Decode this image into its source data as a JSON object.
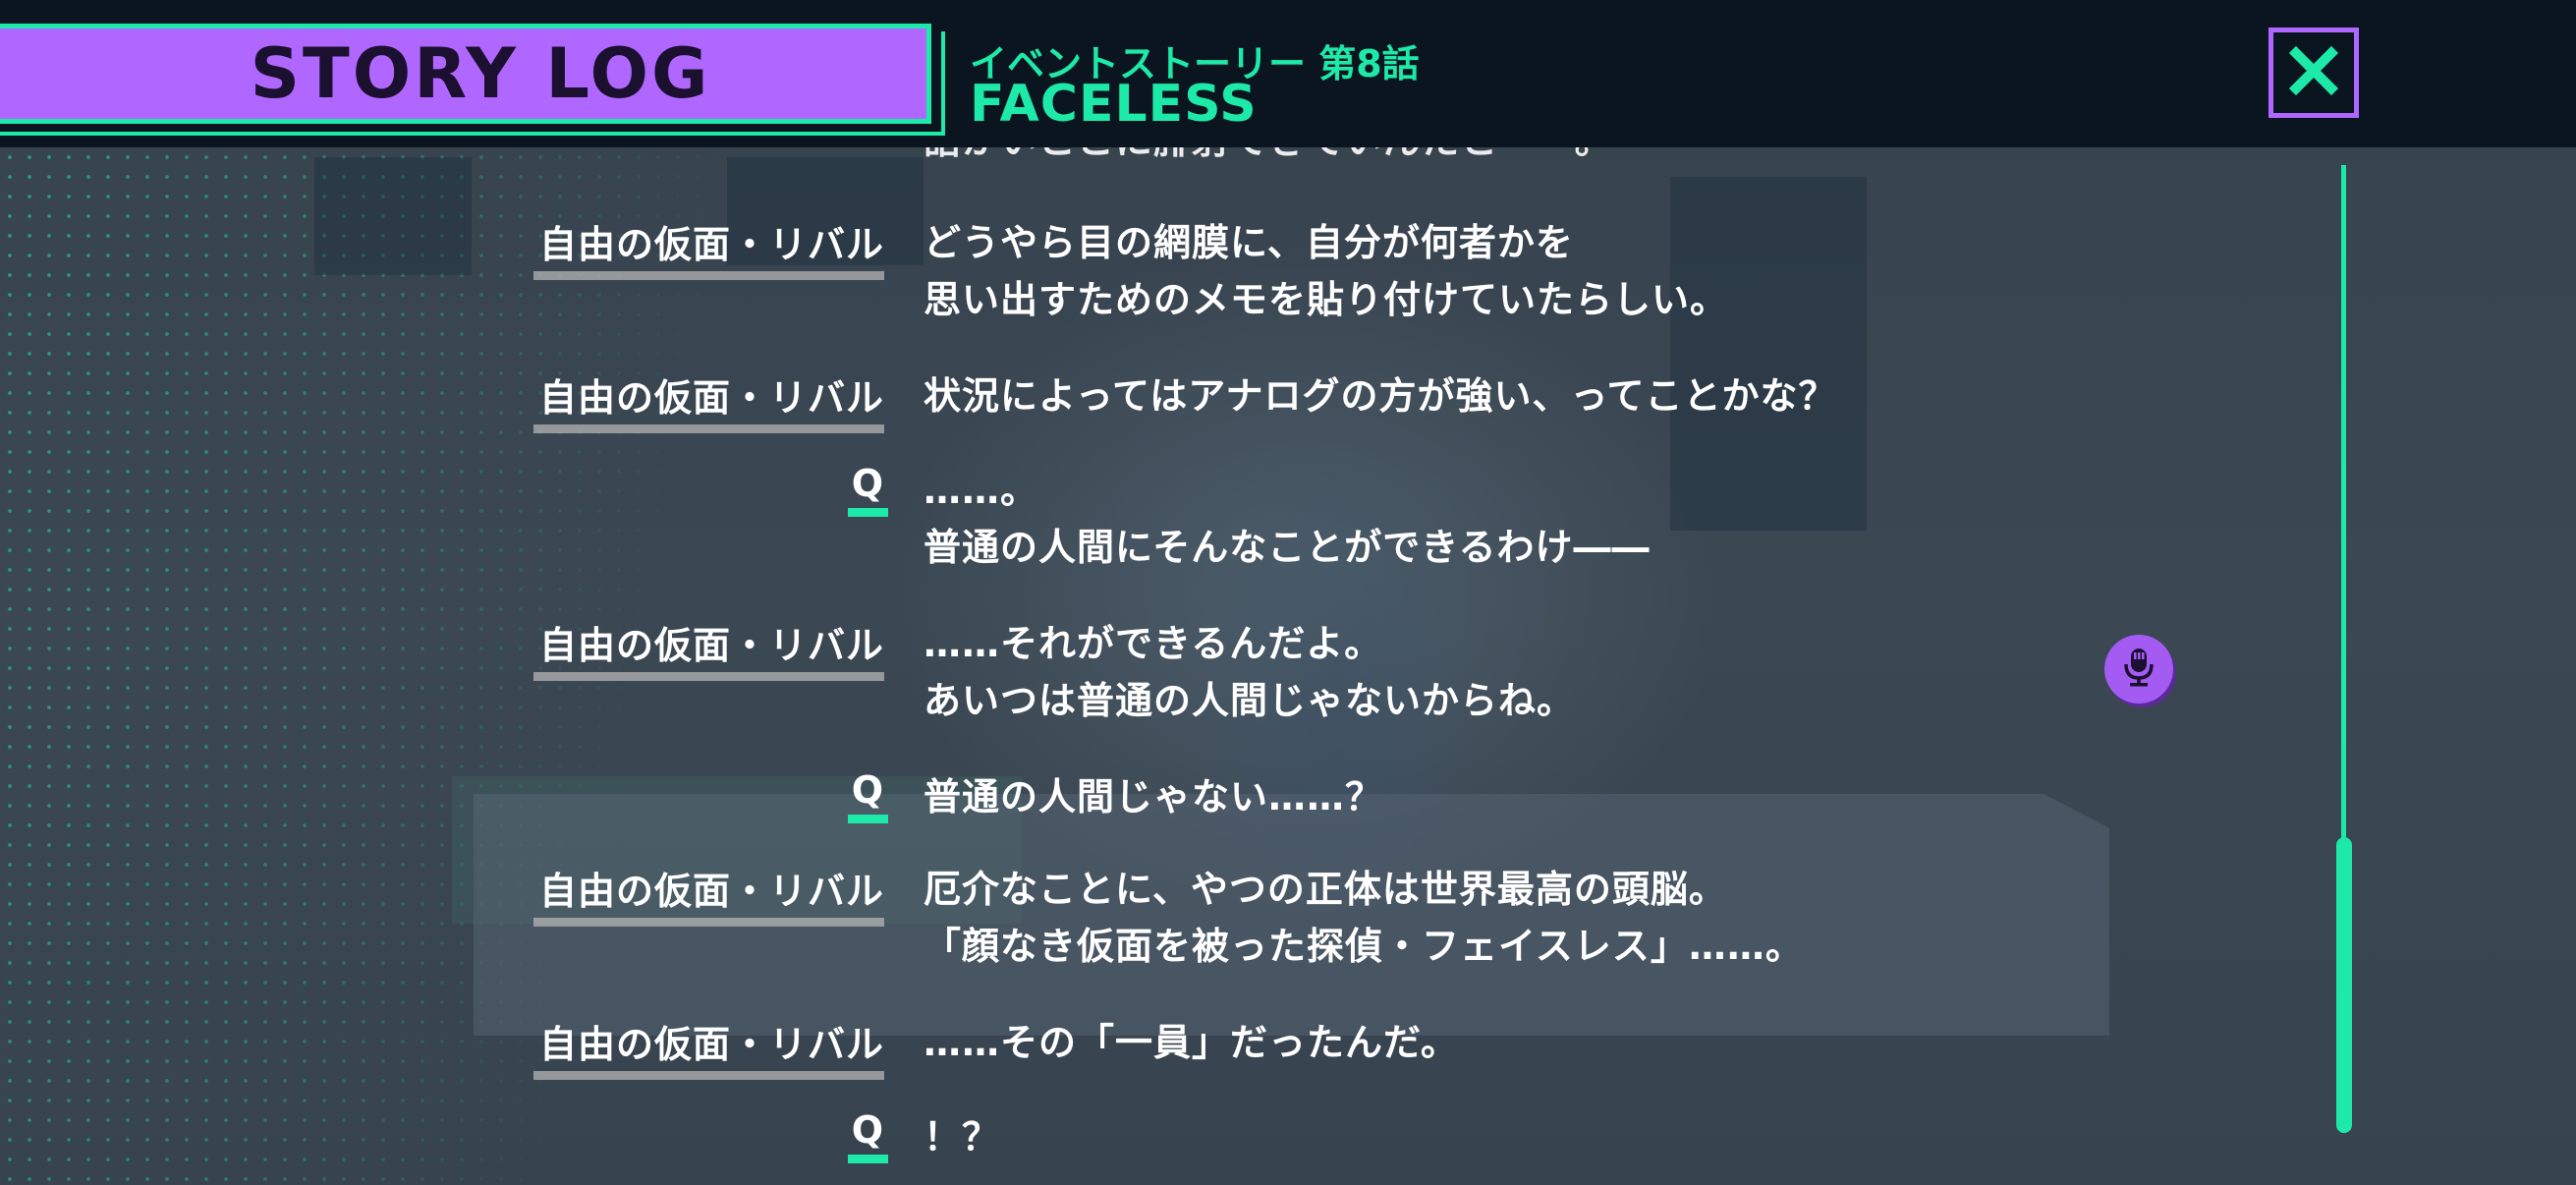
{
  "header": {
    "title": "STORY LOG",
    "episode_label": "イベントストーリー 第8話",
    "episode_title": "FACELESS",
    "close_icon": "close-icon"
  },
  "log": {
    "cut_line": "語かいここに腓射てさていんたとーー。",
    "entries": [
      {
        "speaker": "自由の仮面・リバル",
        "lines": [
          "どうやら目の網膜に、自分が何者かを",
          "思い出すためのメモを貼り付けていたらしい。"
        ]
      },
      {
        "speaker": "自由の仮面・リバル",
        "lines": [
          "状況によってはアナログの方が強い、ってことかな？"
        ]
      },
      {
        "speaker": "Q",
        "lines": [
          "……。",
          "普通の人間にそんなことができるわけ――"
        ]
      },
      {
        "speaker": "自由の仮面・リバル",
        "lines": [
          "……それができるんだよ。",
          "あいつは普通の人間じゃないからね。"
        ]
      },
      {
        "speaker": "Q",
        "lines": [
          "普通の人間じゃない……？"
        ]
      },
      {
        "speaker": "自由の仮面・リバル",
        "lines": [
          "厄介なことに、やつの正体は世界最高の頭脳。",
          "「顔なき仮面を被った探偵・フェイスレス」……。"
        ]
      },
      {
        "speaker": "自由の仮面・リバル",
        "lines": [
          "……その「一員」だったんだ。"
        ]
      },
      {
        "speaker": "Q",
        "lines": [
          "！？"
        ]
      }
    ],
    "voice_icon": "microphone-icon"
  },
  "colors": {
    "accent_green": "#1de9a8",
    "accent_purple": "#b067ff",
    "header_bg": "#0b1520"
  }
}
